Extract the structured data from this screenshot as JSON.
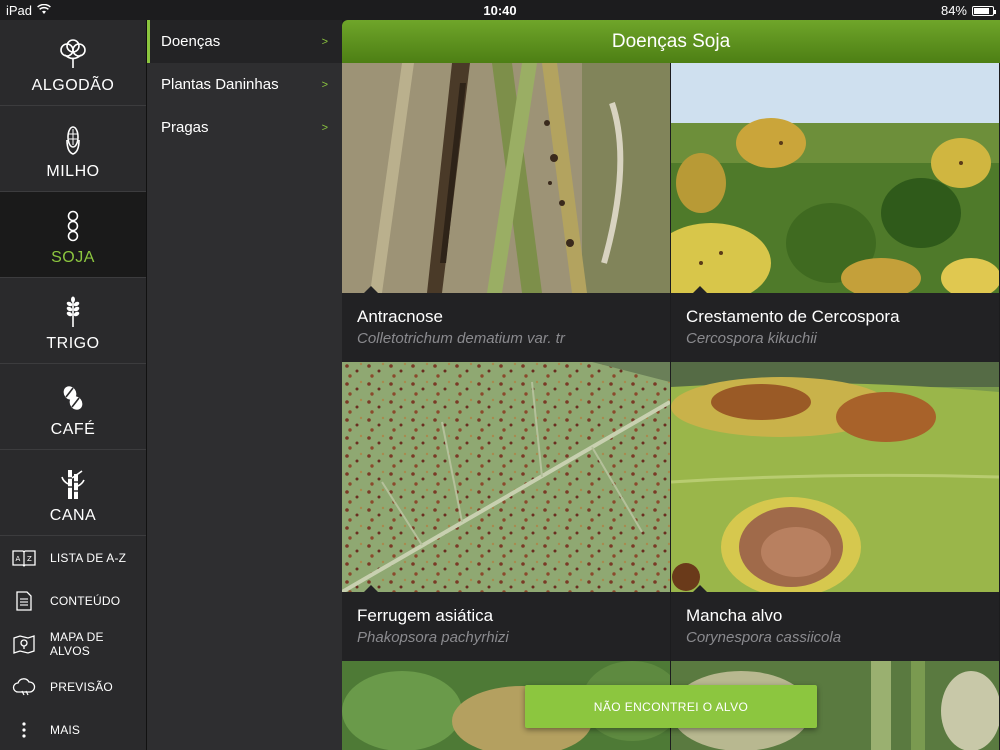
{
  "status_bar": {
    "device": "iPad",
    "time": "10:40",
    "battery": "84%",
    "battery_level": 0.84
  },
  "crops": [
    {
      "label": "ALGODÃO",
      "icon": "cotton-icon"
    },
    {
      "label": "MILHO",
      "icon": "corn-icon"
    },
    {
      "label": "SOJA",
      "icon": "soybean-icon",
      "active": true
    },
    {
      "label": "TRIGO",
      "icon": "wheat-icon"
    },
    {
      "label": "CAFÉ",
      "icon": "coffee-bean-icon"
    },
    {
      "label": "CANA",
      "icon": "sugarcane-icon"
    }
  ],
  "tools": [
    {
      "label": "LISTA DE A-Z",
      "icon": "az-book-icon"
    },
    {
      "label": "CONTEÚDO",
      "icon": "document-icon"
    },
    {
      "label": "MAPA DE ALVOS",
      "icon": "map-pin-icon"
    },
    {
      "label": "PREVISÃO",
      "icon": "cloud-icon"
    },
    {
      "label": "MAIS",
      "icon": "more-vertical-icon"
    }
  ],
  "submenu": [
    {
      "label": "Doenças",
      "chevron": ">",
      "active": true
    },
    {
      "label": "Plantas Daninhas",
      "chevron": ">"
    },
    {
      "label": "Pragas",
      "chevron": ">"
    }
  ],
  "main": {
    "title": "Doenças Soja",
    "cards": [
      {
        "name": "Antracnose",
        "scientific": "Colletotrichum dematium var. tr"
      },
      {
        "name": "Crestamento de Cercospora",
        "scientific": "Cercospora kikuchii"
      },
      {
        "name": "Ferrugem asiática",
        "scientific": "Phakopsora pachyrhizi"
      },
      {
        "name": "Mancha alvo",
        "scientific": "Corynespora cassiicola"
      }
    ],
    "cta_label": "NÃO ENCONTREI O ALVO"
  },
  "colors": {
    "accent": "#8cc63f",
    "header_green": "#5e9420",
    "background": "#1c1c1e"
  }
}
